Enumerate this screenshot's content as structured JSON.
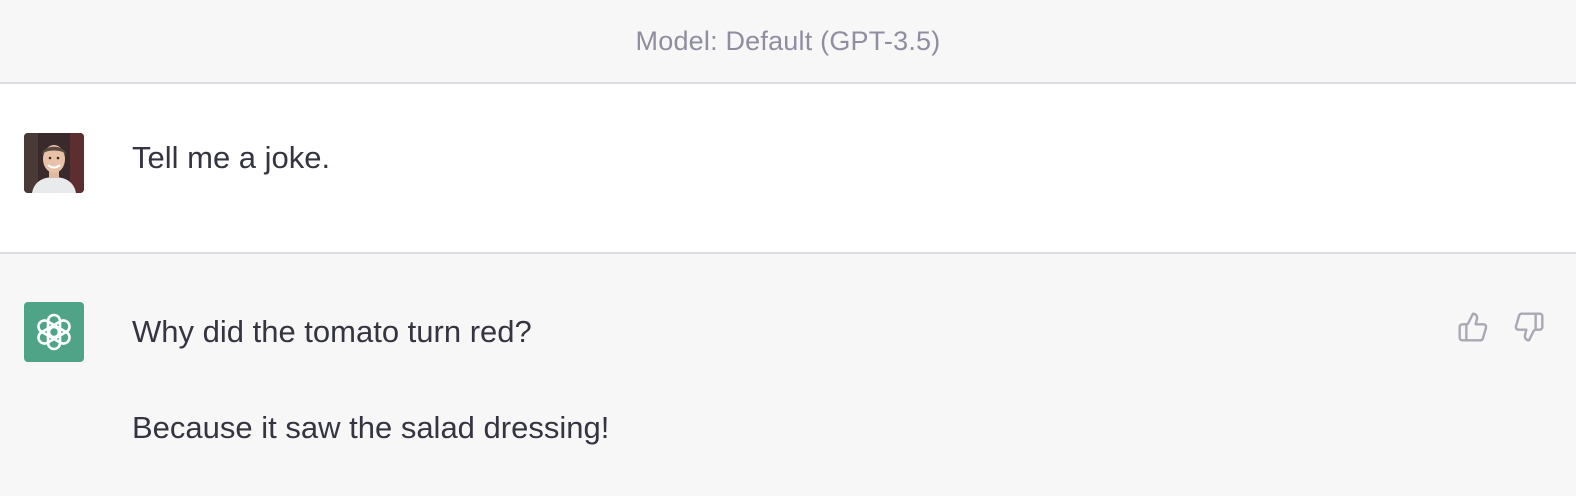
{
  "header": {
    "model_label": "Model: Default (GPT-3.5)"
  },
  "conversation": {
    "user_message": {
      "text": "Tell me a joke."
    },
    "assistant_message": {
      "paragraphs": [
        "Why did the tomato turn red?",
        "Because it saw the salad dressing!"
      ]
    }
  },
  "icons": {
    "assistant_avatar": "openai-logo-icon",
    "thumbs_up": "thumbs-up-icon",
    "thumbs_down": "thumbs-down-icon"
  },
  "colors": {
    "assistant_avatar_bg": "#4fa488",
    "text": "#343541",
    "muted": "#8e8ea0",
    "row_alt_bg": "#f7f7f8"
  }
}
